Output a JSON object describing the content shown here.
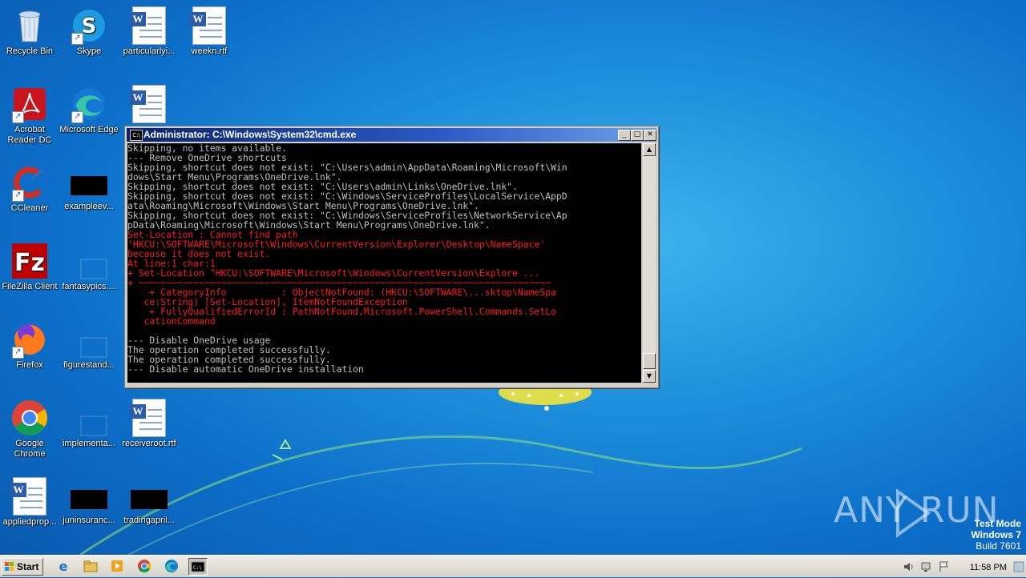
{
  "desktop": {
    "icons": [
      {
        "label": "Recycle Bin"
      },
      {
        "label": "Skype"
      },
      {
        "label": "particularlyi..."
      },
      {
        "label": "weekn.rtf"
      },
      {
        "label": "Acrobat Reader DC"
      },
      {
        "label": "Microsoft Edge"
      },
      {
        "label": "CCleaner"
      },
      {
        "label": "exampleev..."
      },
      {
        "label": "FileZilla Client"
      },
      {
        "label": "fantasypics...."
      },
      {
        "label": "Firefox"
      },
      {
        "label": "figurestand..."
      },
      {
        "label": "Google Chrome"
      },
      {
        "label": "implementa..."
      },
      {
        "label": "receiveroot.rtf"
      },
      {
        "label": "appliedprop..."
      },
      {
        "label": "juninsuranc..."
      },
      {
        "label": "tradingapril..."
      }
    ]
  },
  "cmd": {
    "title": "Administrator: C:\\Windows\\System32\\cmd.exe",
    "icon": "cmd-icon",
    "buttons": {
      "minimize": "_",
      "maximize": "□",
      "close": "✕"
    },
    "lines": [
      {
        "text": "Skipping, no items available.",
        "err": false
      },
      {
        "text": "--- Remove OneDrive shortcuts",
        "err": false
      },
      {
        "text": "Skipping, shortcut does not exist: \"C:\\Users\\admin\\AppData\\Roaming\\Microsoft\\Win",
        "err": false
      },
      {
        "text": "dows\\Start Menu\\Programs\\OneDrive.lnk\".",
        "err": false
      },
      {
        "text": "Skipping, shortcut does not exist: \"C:\\Users\\admin\\Links\\OneDrive.lnk\".",
        "err": false
      },
      {
        "text": "Skipping, shortcut does not exist: \"C:\\Windows\\ServiceProfiles\\LocalService\\AppD",
        "err": false
      },
      {
        "text": "ata\\Roaming\\Microsoft\\Windows\\Start Menu\\Programs\\OneDrive.lnk\".",
        "err": false
      },
      {
        "text": "Skipping, shortcut does not exist: \"C:\\Windows\\ServiceProfiles\\NetworkService\\Ap",
        "err": false
      },
      {
        "text": "pData\\Roaming\\Microsoft\\Windows\\Start Menu\\Programs\\OneDrive.lnk\".",
        "err": false
      },
      {
        "text": "Set-Location : Cannot find path",
        "err": true
      },
      {
        "text": "'HKCU:\\SOFTWARE\\Microsoft\\Windows\\CurrentVersion\\Explorer\\Desktop\\NameSpace'",
        "err": true
      },
      {
        "text": "because it does not exist.",
        "err": true
      },
      {
        "text": "At line:1 char:1",
        "err": true
      },
      {
        "text": "+ Set-Location \"HKCU:\\SOFTWARE\\Microsoft\\Windows\\CurrentVersion\\Explore ...",
        "err": true
      },
      {
        "text": "+ ~~~~~~~~~~~~~~~~~~~~~~~~~~~~~~~~~~~~~~~~~~~~~~~~~~~~~~~~~~~~~~~~~~~~~~~~~~~",
        "err": true
      },
      {
        "text": "    + CategoryInfo          : ObjectNotFound: (HKCU:\\SOFTWARE\\...sktop\\NameSpa",
        "err": true
      },
      {
        "text": "   ce:String) [Set-Location], ItemNotFoundException",
        "err": true
      },
      {
        "text": "    + FullyQualifiedErrorId : PathNotFound,Microsoft.PowerShell.Commands.SetLo",
        "err": true
      },
      {
        "text": "   cationCommand",
        "err": true
      },
      {
        "text": "",
        "err": false
      },
      {
        "text": "--- Disable OneDrive usage",
        "err": false
      },
      {
        "text": "The operation completed successfully.",
        "err": false
      },
      {
        "text": "The operation completed successfully.",
        "err": false
      },
      {
        "text": "--- Disable automatic OneDrive installation",
        "err": false
      }
    ]
  },
  "watermark": {
    "brand": "ANY RUN",
    "test_mode": "Test Mode",
    "os": "Windows 7",
    "build": "Build 7601"
  },
  "taskbar": {
    "start_label": "Start",
    "pinned": [
      "ie-icon",
      "explorer-icon",
      "media-player-icon",
      "chrome-icon",
      "edge-icon",
      "cmd-icon"
    ],
    "clock": "11:58 PM"
  }
}
